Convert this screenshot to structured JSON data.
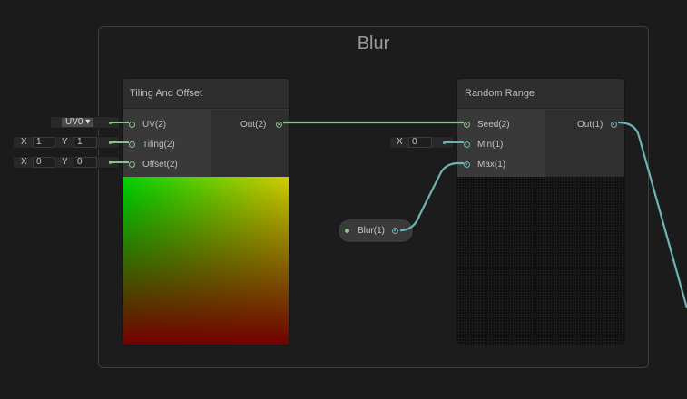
{
  "group": {
    "title": "Blur"
  },
  "tiling_node": {
    "title": "Tiling And Offset",
    "inputs": [
      "UV(2)",
      "Tiling(2)",
      "Offset(2)"
    ],
    "output": "Out(2)"
  },
  "random_node": {
    "title": "Random Range",
    "inputs": [
      "Seed(2)",
      "Min(1)",
      "Max(1)"
    ],
    "output": "Out(1)"
  },
  "uv_dropdown": {
    "value": "UV0 ▾"
  },
  "tiling_field": {
    "x_label": "X",
    "x_value": "1",
    "y_label": "Y",
    "y_value": "1"
  },
  "offset_field": {
    "x_label": "X",
    "x_value": "0",
    "y_label": "Y",
    "y_value": "0"
  },
  "min_field": {
    "x_label": "X",
    "x_value": "0"
  },
  "blur_property": {
    "label": "Blur(1)"
  },
  "colors": {
    "vector2_wire": "#8ec28c",
    "float_wire": "#6fb2b6"
  }
}
